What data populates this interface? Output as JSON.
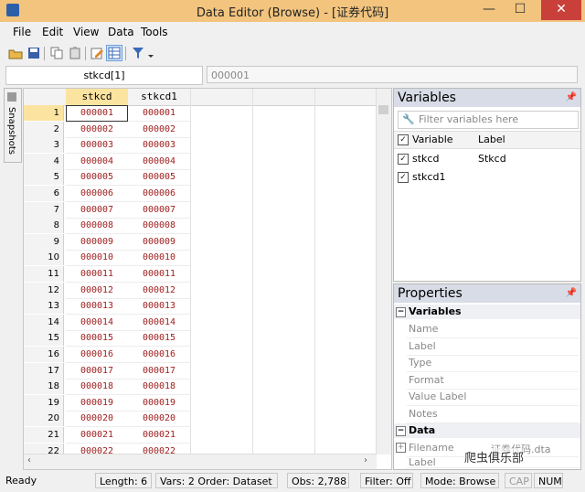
{
  "window": {
    "title": "Data Editor (Browse) - [证券代码]",
    "controls": {
      "minimize": "—",
      "maximize": "☐",
      "close": "✕"
    }
  },
  "menu": [
    "File",
    "Edit",
    "View",
    "Data",
    "Tools"
  ],
  "cell_editor": {
    "name": "stkcd[1]",
    "value": "000001"
  },
  "snapshots_label": "Snapshots",
  "grid": {
    "columns": [
      "stkcd",
      "stkcd1"
    ],
    "rows": [
      {
        "n": "1",
        "a": "000001",
        "b": "000001"
      },
      {
        "n": "2",
        "a": "000002",
        "b": "000002"
      },
      {
        "n": "3",
        "a": "000003",
        "b": "000003"
      },
      {
        "n": "4",
        "a": "000004",
        "b": "000004"
      },
      {
        "n": "5",
        "a": "000005",
        "b": "000005"
      },
      {
        "n": "6",
        "a": "000006",
        "b": "000006"
      },
      {
        "n": "7",
        "a": "000007",
        "b": "000007"
      },
      {
        "n": "8",
        "a": "000008",
        "b": "000008"
      },
      {
        "n": "9",
        "a": "000009",
        "b": "000009"
      },
      {
        "n": "10",
        "a": "000010",
        "b": "000010"
      },
      {
        "n": "11",
        "a": "000011",
        "b": "000011"
      },
      {
        "n": "12",
        "a": "000012",
        "b": "000012"
      },
      {
        "n": "13",
        "a": "000013",
        "b": "000013"
      },
      {
        "n": "14",
        "a": "000014",
        "b": "000014"
      },
      {
        "n": "15",
        "a": "000015",
        "b": "000015"
      },
      {
        "n": "16",
        "a": "000016",
        "b": "000016"
      },
      {
        "n": "17",
        "a": "000017",
        "b": "000017"
      },
      {
        "n": "18",
        "a": "000018",
        "b": "000018"
      },
      {
        "n": "19",
        "a": "000019",
        "b": "000019"
      },
      {
        "n": "20",
        "a": "000020",
        "b": "000020"
      },
      {
        "n": "21",
        "a": "000021",
        "b": "000021"
      },
      {
        "n": "22",
        "a": "000022",
        "b": "000022"
      }
    ]
  },
  "variables_panel": {
    "title": "Variables",
    "filter_placeholder": "Filter variables here",
    "col_variable": "Variable",
    "col_label": "Label",
    "items": [
      {
        "name": "stkcd",
        "label": "Stkcd"
      },
      {
        "name": "stkcd1",
        "label": ""
      }
    ]
  },
  "properties_panel": {
    "title": "Properties",
    "group_variables": "Variables",
    "var_props": [
      "Name",
      "Label",
      "Type",
      "Format",
      "Value Label",
      "Notes"
    ],
    "group_data": "Data",
    "data_props": [
      {
        "key": "Filename",
        "value": "证券代码.dta"
      },
      {
        "key": "Label",
        "value": ""
      }
    ]
  },
  "status": {
    "ready": "Ready",
    "length": "Length: 6",
    "vars": "Vars: 2",
    "order": "Order: Dataset",
    "obs": "Obs: 2,788",
    "filter": "Filter: Off",
    "mode": "Mode: Browse",
    "cap": "CAP",
    "num": "NUM"
  },
  "watermark": "爬虫俱乐部"
}
